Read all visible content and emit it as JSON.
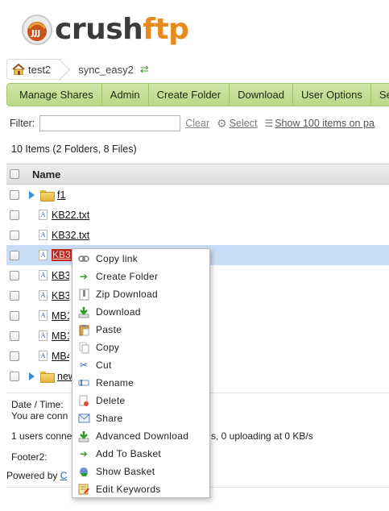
{
  "logo": {
    "text_a": "crush",
    "text_b": "ftp"
  },
  "breadcrumb": {
    "home_label": "test2",
    "current": "sync_easy2"
  },
  "toolbar": [
    "Manage Shares",
    "Admin",
    "Create Folder",
    "Download",
    "User Options",
    "Se"
  ],
  "filter": {
    "label": "Filter:",
    "value": "",
    "clear": "Clear",
    "select": "Select",
    "show": "Show 100 items on pa"
  },
  "item_count": "10 Items (2 Folders, 8 Files)",
  "table": {
    "header": "Name",
    "rows": [
      {
        "name": "f1",
        "type": "folder"
      },
      {
        "name": "KB22.txt",
        "type": "file"
      },
      {
        "name": "KB32.txt",
        "type": "file"
      },
      {
        "name": "KB3",
        "type": "file",
        "selected": true
      },
      {
        "name": "KB3",
        "type": "file"
      },
      {
        "name": "KB3",
        "type": "file"
      },
      {
        "name": "MB1",
        "type": "file"
      },
      {
        "name": "MB1",
        "type": "file"
      },
      {
        "name": "MB4",
        "type": "file"
      },
      {
        "name": "new",
        "type": "folder"
      }
    ]
  },
  "footer": {
    "date_time": "Date / Time:",
    "connected": "You are conn",
    "users": "1 users conne",
    "users_tail": "s, 0 uploading at 0 KB/s",
    "footer2": "Footer2:",
    "powered": "Powered by",
    "powered_link": "C"
  },
  "context_menu": [
    {
      "label": "Copy link",
      "icon": "link-icon"
    },
    {
      "label": "Create Folder",
      "icon": "green-arrow-icon"
    },
    {
      "label": "Zip Download",
      "icon": "zip-icon"
    },
    {
      "label": "Download",
      "icon": "download-icon"
    },
    {
      "label": "Paste",
      "icon": "clipboard-icon"
    },
    {
      "label": "Copy",
      "icon": "copy-icon"
    },
    {
      "label": "Cut",
      "icon": "scissors-icon"
    },
    {
      "label": "Rename",
      "icon": "rename-icon"
    },
    {
      "label": "Delete",
      "icon": "delete-icon"
    },
    {
      "label": "Share",
      "icon": "envelope-icon"
    },
    {
      "label": "Advanced Download",
      "icon": "download-icon"
    },
    {
      "label": "Add To Basket",
      "icon": "green-arrow-icon"
    },
    {
      "label": "Show Basket",
      "icon": "basket-icon"
    },
    {
      "label": "Edit Keywords",
      "icon": "edit-icon"
    }
  ],
  "colors": {
    "toolbar_bg": "#c4df97",
    "selection_bg": "#c8dcf5",
    "selected_name_bg": "#c0271f",
    "logo_accent": "#e88a1a"
  }
}
